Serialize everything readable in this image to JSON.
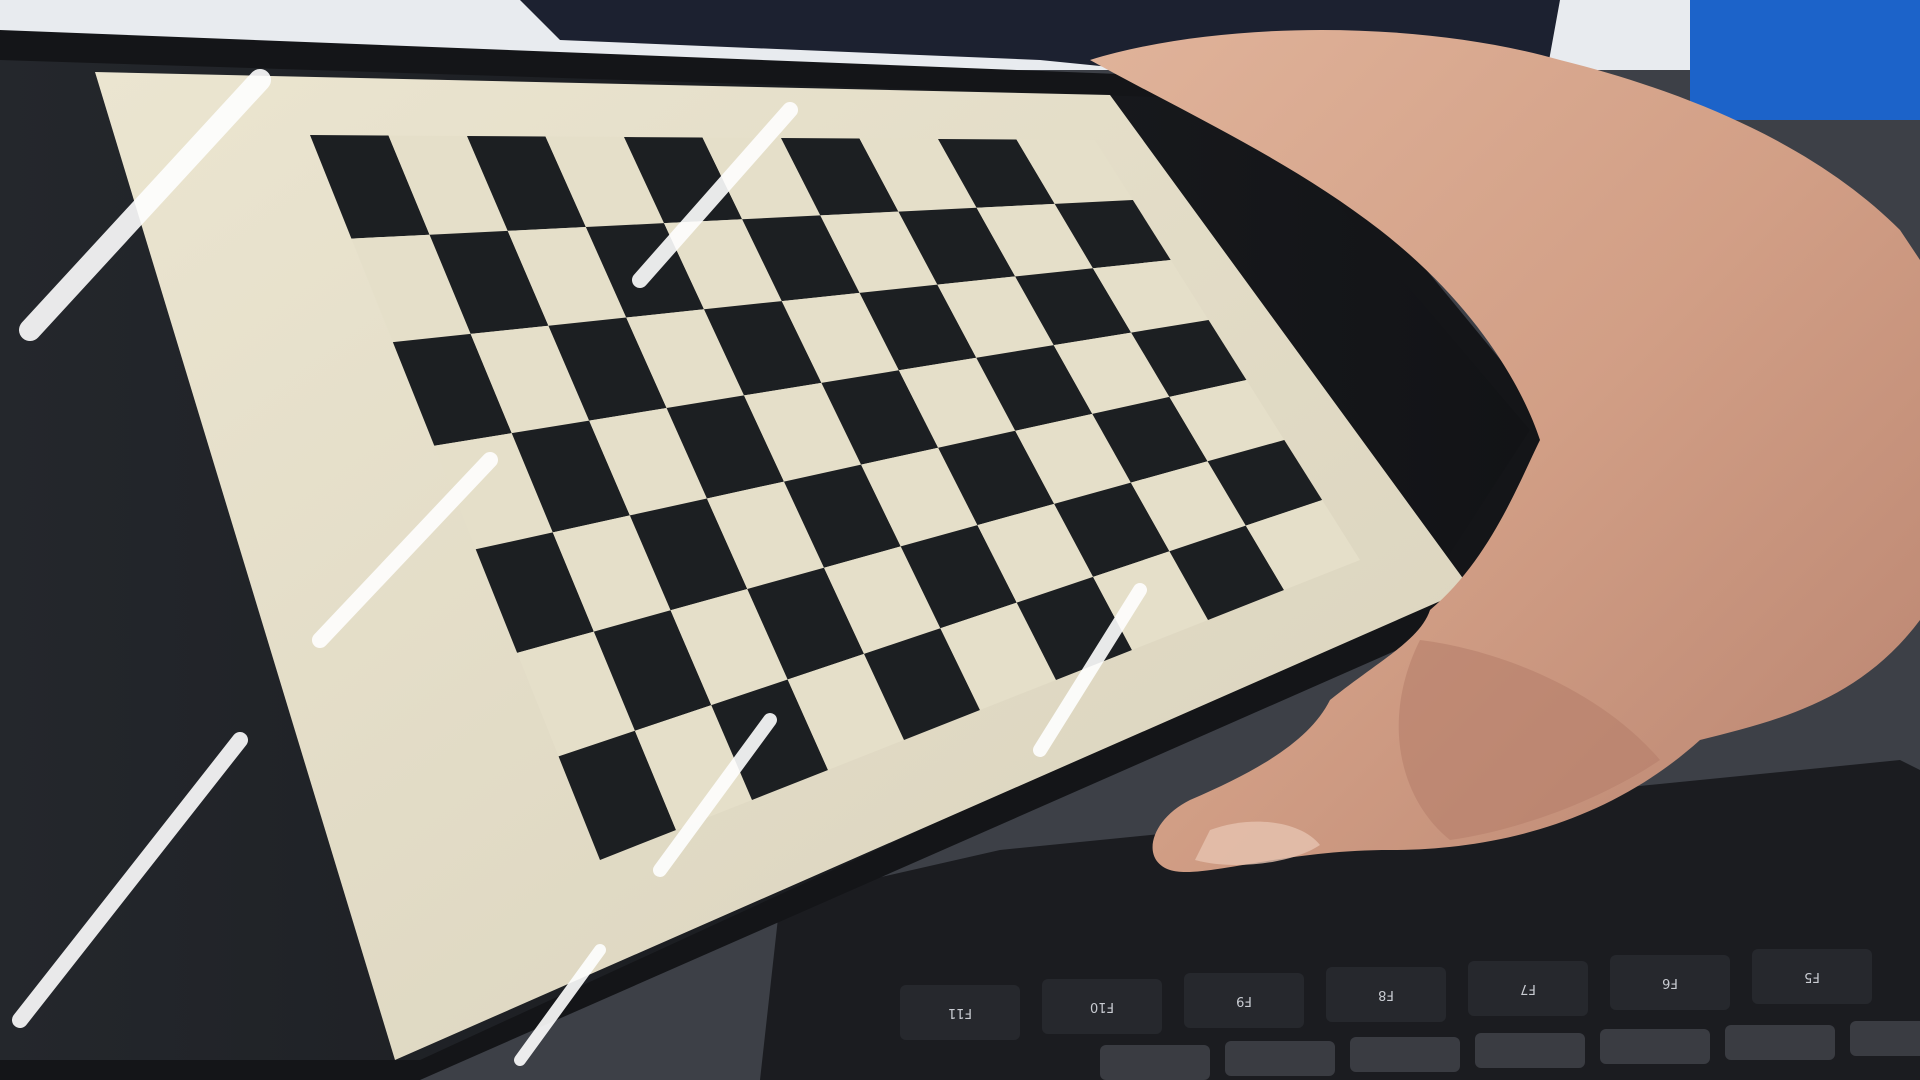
{
  "scene": {
    "subject": "hand-holding-phone",
    "phone_screen": {
      "pattern": "checkerboard",
      "rows": 7,
      "cols": 10,
      "light_color": "#e5dfc9",
      "dark_color": "#1c1f22",
      "glare_color": "#ffffff"
    },
    "background": {
      "desk_color": "#3d4047",
      "shirt_color": "#1c2130",
      "skin_color": "#d6a48a"
    },
    "keyboard": {
      "color": "#1b1c20",
      "fkey_labels": [
        "F11",
        "F10",
        "F9",
        "F8",
        "F7",
        "F6",
        "F5"
      ]
    }
  }
}
